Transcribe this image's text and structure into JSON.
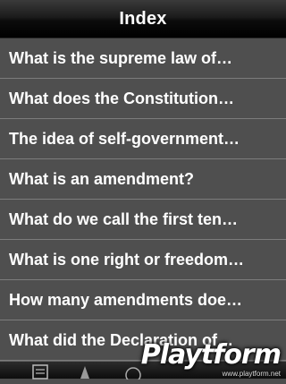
{
  "navbar": {
    "title": "Index"
  },
  "list": {
    "items": [
      "What is the supreme law of…",
      "What does the Constitution…",
      "The idea of self-government…",
      "What is an amendment?",
      "What do we call the first ten…",
      "What is one right or freedom…",
      "How many amendments doe…",
      "What did the Declaration of…"
    ]
  },
  "watermark": {
    "brand": "Playtform",
    "url": "www.playtform.net"
  },
  "tabbar": {
    "icons": [
      "index-tab-icon",
      "study-tab-icon",
      "quiz-tab-icon"
    ]
  }
}
